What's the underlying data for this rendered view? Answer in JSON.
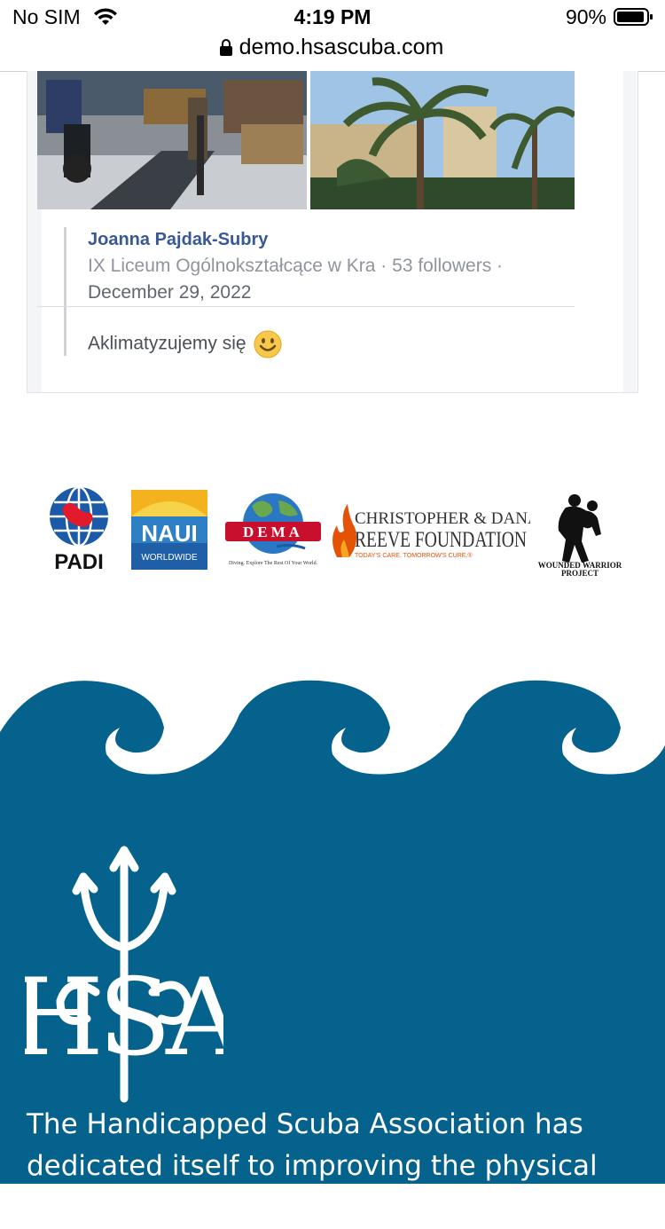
{
  "status_bar": {
    "carrier": "No SIM",
    "time": "4:19 PM",
    "battery": "90%"
  },
  "browser": {
    "url": "demo.hsascuba.com"
  },
  "post": {
    "author": "Joanna Pajdak-Subry",
    "meta": "IX Liceum Ogólnokształcące w Kra · 53 followers ·",
    "date": "December 29, 2022",
    "message": "Aklimatyzujemy się"
  },
  "partners": {
    "padi": "PADI",
    "naui_top": "NAUI",
    "naui_bottom": "WORLDWIDE",
    "dema": "DEMA",
    "dema_tagline": "Diving. Explore The Rest Of Your World.",
    "reeve_line1": "CHRISTOPHER & DANA",
    "reeve_line2": "REEVE FOUNDATION",
    "reeve_tagline": "TODAY'S CARE. TOMORROW'S CURE.®",
    "wwp_line1": "WOUNDED WARRIOR",
    "wwp_line2": "PROJECT"
  },
  "footer": {
    "logo_letters": "HSA",
    "description": "The Handicapped Scuba Association has dedicated itself to improving the physical and"
  },
  "colors": {
    "footer_blue": "#05628c",
    "link_blue": "#385898"
  }
}
